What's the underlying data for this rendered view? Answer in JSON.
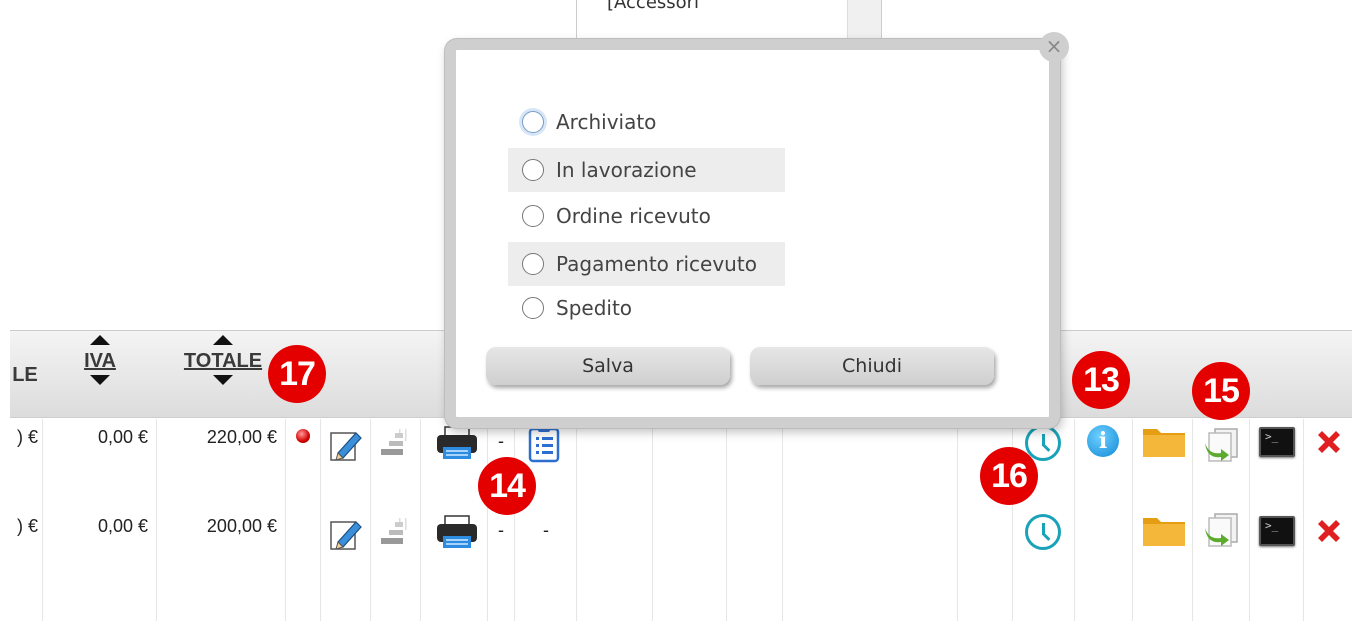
{
  "background_dropdown": {
    "text": "[Accessori"
  },
  "modal": {
    "options": [
      {
        "label": "Archiviato"
      },
      {
        "label": "In lavorazione"
      },
      {
        "label": "Ordine ricevuto"
      },
      {
        "label": "Pagamento ricevuto"
      },
      {
        "label": "Spedito"
      }
    ],
    "save_label": "Salva",
    "close_label": "Chiudi",
    "close_icon": "×"
  },
  "table": {
    "headers": {
      "totale_partial": "LE",
      "iva": "IVA",
      "totale": "TOTALE"
    },
    "rows": [
      {
        "partial": ") €",
        "iva": "0,00 €",
        "totale": "220,00 €",
        "dash1": "-"
      },
      {
        "partial": ") €",
        "iva": "0,00 €",
        "totale": "200,00 €",
        "dash1": "-",
        "dash2": "-"
      }
    ]
  },
  "markers": {
    "m13": "13",
    "m14": "14",
    "m15": "15",
    "m16": "16",
    "m17": "17"
  },
  "icons": {
    "status": "red-dot-icon",
    "edit": "pencil-icon",
    "bars": "barcode-icon",
    "print": "printer-icon",
    "list": "clipboard-list-icon",
    "history": "clock-icon",
    "info": "info-icon",
    "folder": "folder-icon",
    "copy": "document-arrow-icon",
    "terminal": "terminal-icon",
    "delete": "red-x-icon"
  },
  "colors": {
    "marker": "#e50000",
    "clock": "#1aa3b8",
    "info": "#1089d6",
    "delete": "#e02020"
  }
}
